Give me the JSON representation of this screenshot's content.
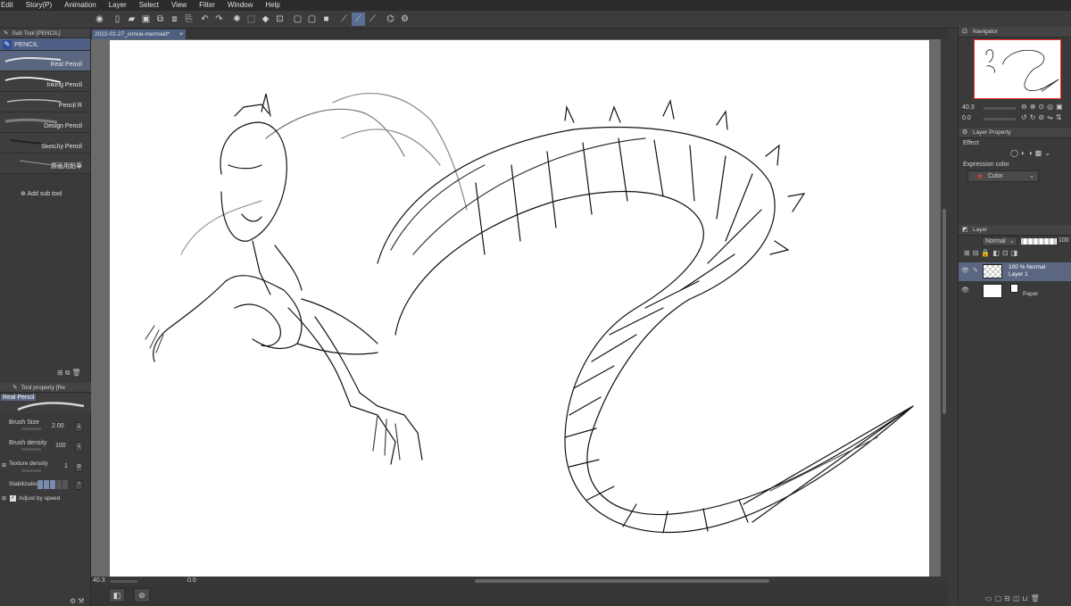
{
  "menu": [
    "Edit",
    "Story(P)",
    "Animation",
    "Layer",
    "Select",
    "View",
    "Filter",
    "Window",
    "Help"
  ],
  "subtool_panel": {
    "title": "Sub Tool [PENCIL]",
    "group": "PENCIL",
    "brushes": [
      "Real Pencil",
      "Inking Pencil",
      "Pencil R",
      "Design Pencil",
      "Sketchy Pencil",
      "原画用鉛筆"
    ],
    "selected": "Real Pencil",
    "add_label": "Add sub tool"
  },
  "tool_property": {
    "title": "Tool property [Re",
    "tool_name": "Real Pencil",
    "brush_size_label": "Brush Size",
    "brush_size": "2.00",
    "brush_density_label": "Brush density",
    "brush_density": "100",
    "texture_density_label": "Texture density",
    "texture_density": "1",
    "stabilization_label": "Stabilization",
    "adjust_label": "Adjust by speed"
  },
  "document": {
    "tab_title": "2022-01-27_cimrai-mermaid*",
    "zoom": "40.3",
    "rotation": "0.0"
  },
  "navigator": {
    "title": "Navigator",
    "zoom": "40.3",
    "rotation": "0.0"
  },
  "layer_property": {
    "title": "Layer Property",
    "effect_label": "Effect",
    "expression_label": "Expression color",
    "expression_value": "Color"
  },
  "layers": {
    "title": "Layer",
    "blend_mode": "Normal",
    "opacity": "100",
    "items": [
      {
        "line1": "100 % Normal",
        "line2": "Layer 1"
      },
      {
        "line1": "",
        "line2": "Paper"
      }
    ]
  },
  "colors": {
    "accent": "#5b6680",
    "panel": "#3a3a3a",
    "selection_frame": "#ff2a2a"
  }
}
